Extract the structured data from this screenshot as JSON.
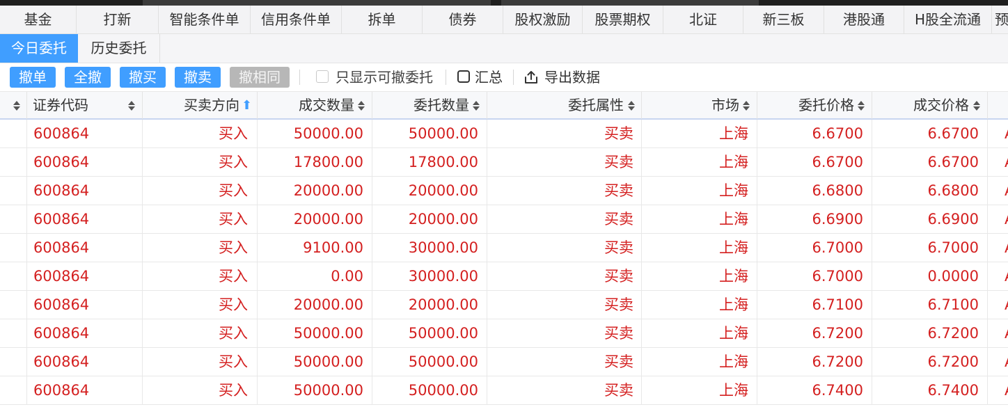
{
  "nav_tabs": [
    "基金",
    "打新",
    "智能条件单",
    "信用条件单",
    "拆单",
    "债券",
    "股权激励",
    "股票期权",
    "北证",
    "新三板",
    "港股通",
    "H股全流通",
    "预"
  ],
  "sub_tabs": [
    "今日委托",
    "历史委托"
  ],
  "toolbar": {
    "cancel_order": "撤单",
    "cancel_all": "全撤",
    "cancel_buy": "撤买",
    "cancel_sell": "撤卖",
    "cancel_same": "撤相同",
    "only_cancelable": "只显示可撤委托",
    "summary": "汇总",
    "export": "导出数据"
  },
  "columns": [
    "证券代码",
    "买卖方向",
    "成交数量",
    "委托数量",
    "委托属性",
    "市场",
    "委托价格",
    "成交价格"
  ],
  "rows": [
    [
      "600864",
      "买入",
      "50000.00",
      "50000.00",
      "买卖",
      "上海",
      "6.6700",
      "6.6700"
    ],
    [
      "600864",
      "买入",
      "17800.00",
      "17800.00",
      "买卖",
      "上海",
      "6.6700",
      "6.6700"
    ],
    [
      "600864",
      "买入",
      "20000.00",
      "20000.00",
      "买卖",
      "上海",
      "6.6800",
      "6.6800"
    ],
    [
      "600864",
      "买入",
      "20000.00",
      "20000.00",
      "买卖",
      "上海",
      "6.6900",
      "6.6900"
    ],
    [
      "600864",
      "买入",
      "9100.00",
      "30000.00",
      "买卖",
      "上海",
      "6.7000",
      "6.7000"
    ],
    [
      "600864",
      "买入",
      "0.00",
      "30000.00",
      "买卖",
      "上海",
      "6.7000",
      "0.0000"
    ],
    [
      "600864",
      "买入",
      "20000.00",
      "20000.00",
      "买卖",
      "上海",
      "6.7100",
      "6.7100"
    ],
    [
      "600864",
      "买入",
      "50000.00",
      "50000.00",
      "买卖",
      "上海",
      "6.7200",
      "6.7200"
    ],
    [
      "600864",
      "买入",
      "50000.00",
      "50000.00",
      "买卖",
      "上海",
      "6.7200",
      "6.7200"
    ],
    [
      "600864",
      "买入",
      "50000.00",
      "50000.00",
      "买卖",
      "上海",
      "6.7400",
      "6.7400"
    ]
  ],
  "colors": {
    "accent": "#409eff",
    "buy_text": "#d42020",
    "disabled_button": "#b7b7b7"
  }
}
